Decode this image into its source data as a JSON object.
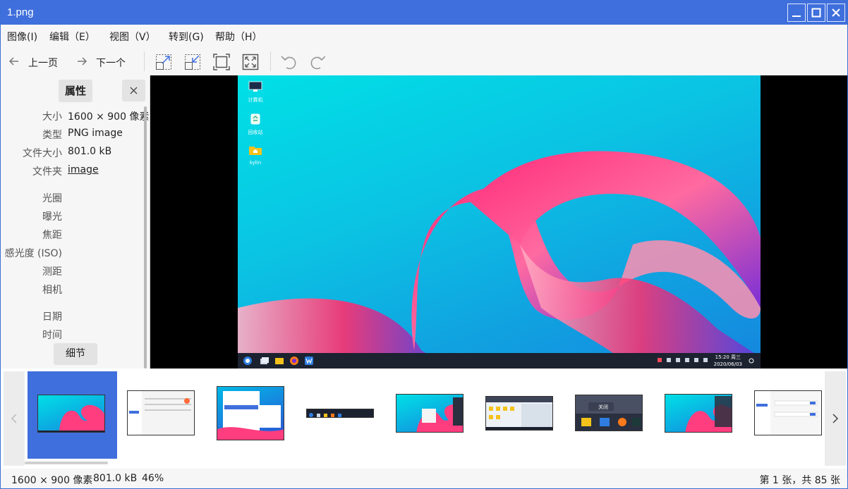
{
  "window": {
    "title": "1.png",
    "accent": "#3f6fdc"
  },
  "menu": [
    "图像(I)",
    "编辑（E）",
    "视图（V）",
    "转到(G)",
    "帮助（H）"
  ],
  "toolbar": {
    "prev_label": "上一页",
    "next_label": "下一个"
  },
  "side_panel": {
    "tab_label": "属性",
    "properties": [
      {
        "label": "大小",
        "value": "1600 × 900 像素"
      },
      {
        "label": "类型",
        "value": "PNG image"
      },
      {
        "label": "文件大小",
        "value": "801.0 kB"
      },
      {
        "label": "文件夹",
        "value": "image"
      }
    ],
    "exif_labels": [
      "光圈",
      "曝光",
      "焦距",
      "感光度 (ISO)",
      "测距",
      "相机"
    ],
    "date_labels": [
      "日期",
      "时间"
    ],
    "details_label": "细节"
  },
  "desktop": {
    "icons": [
      "计算机",
      "回收站",
      "kylin"
    ],
    "clock_time": "15:20 周三",
    "clock_date": "2020/06/03"
  },
  "filmstrip": {
    "count_visible": 9,
    "thumb_menu_item": "关闭"
  },
  "status": {
    "size": "1600 × 900 像素",
    "filesize": "801.0 kB",
    "zoom": "46%",
    "position": "第 1 张，共 85 张"
  }
}
